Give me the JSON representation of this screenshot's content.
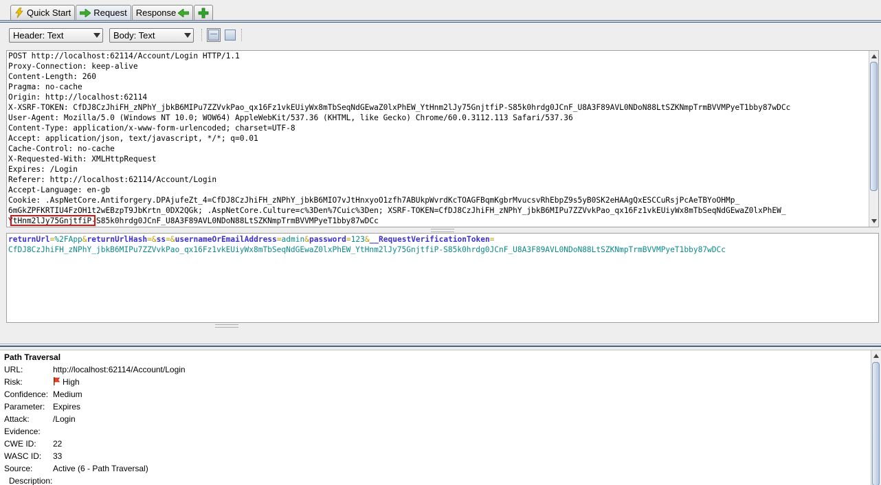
{
  "tabs": [
    {
      "label": "Quick Start",
      "icon": "lightning-icon",
      "active": false
    },
    {
      "label": "Request",
      "icon": "green-arrow-right-icon",
      "active": true
    },
    {
      "label": "Response",
      "icon": "green-arrow-left-icon",
      "active": false
    },
    {
      "label": "",
      "icon": "add-tab-icon",
      "active": false
    }
  ],
  "toolbar": {
    "header_view": "Header: Text",
    "body_view": "Body: Text"
  },
  "request_header": {
    "lines": [
      "POST http://localhost:62114/Account/Login HTTP/1.1",
      "Proxy-Connection: keep-alive",
      "Content-Length: 260",
      "Pragma: no-cache",
      "Origin: http://localhost:62114",
      "X-XSRF-TOKEN: CfDJ8CzJhiFH_zNPhY_jbkB6MIPu7ZZVvkPao_qx16Fz1vkEUiyWx8mTbSeqNdGEwaZ0lxPhEW_YtHnm2lJy75GnjtfiP-S85k0hrdg0JCnF_U8A3F89AVL0NDoN88LtSZKNmpTrmBVVMPyeT1bby87wDCc",
      "User-Agent: Mozilla/5.0 (Windows NT 10.0; WOW64) AppleWebKit/537.36 (KHTML, like Gecko) Chrome/60.0.3112.113 Safari/537.36",
      "Content-Type: application/x-www-form-urlencoded; charset=UTF-8",
      "Accept: application/json, text/javascript, */*; q=0.01",
      "Cache-Control: no-cache",
      "X-Requested-With: XMLHttpRequest",
      "Expires: /Login",
      "Referer: http://localhost:62114/Account/Login",
      "Accept-Language: en-gb",
      "Cookie: .AspNetCore.Antiforgery.DPAjufeZt_4=CfDJ8CzJhiFH_zNPhY_jbkB6MIO7vJtHnxyoO1zfh7ABUkpWvrdKcTOAGFBqmKgbrMvucsvRhEbpZ9s5yB0SK2eHAAgQxESCCuRsjPcAeTBYoOHMp_",
      "6mGkZPFKRTIU4FzOH1t2wEBzpT9JbKrtn_0DX2QGk; .AspNetCore.Culture=c%3Den%7Cuic%3Den; XSRF-TOKEN=CfDJ8CzJhiFH_zNPhY_jbkB6MIPu7ZZVvkPao_qx16Fz1vkEUiyWx8mTbSeqNdGEwaZ0lxPhEW_",
      "YtHnm2lJy75GnjtfiP-S85k0hrdg0JCnF_U8A3F89AVL0NDoN88LtSZKNmpTrmBVVMPyeT1bby87wDCc"
    ]
  },
  "request_body": {
    "segments": [
      {
        "t": "k",
        "s": "returnUrl"
      },
      {
        "t": "o",
        "s": "="
      },
      {
        "t": "v",
        "s": "%2FApp"
      },
      {
        "t": "o",
        "s": "&"
      },
      {
        "t": "k",
        "s": "returnUrlHash"
      },
      {
        "t": "o",
        "s": "="
      },
      {
        "t": "o",
        "s": "&"
      },
      {
        "t": "k",
        "s": "ss"
      },
      {
        "t": "o",
        "s": "="
      },
      {
        "t": "o",
        "s": "&"
      },
      {
        "t": "k",
        "s": "usernameOrEmailAddress"
      },
      {
        "t": "o",
        "s": "="
      },
      {
        "t": "v",
        "s": "admin"
      },
      {
        "t": "o",
        "s": "&"
      },
      {
        "t": "k",
        "s": "password"
      },
      {
        "t": "o",
        "s": "="
      },
      {
        "t": "v",
        "s": "123"
      },
      {
        "t": "o",
        "s": "&"
      },
      {
        "t": "k",
        "s": "__RequestVerificationToken"
      },
      {
        "t": "o",
        "s": "="
      },
      {
        "t": "br",
        "s": ""
      },
      {
        "t": "v",
        "s": "CfDJ8CzJhiFH_zNPhY_jbkB6MIPu7ZZVvkPao_qx16Fz1vkEUiyWx8mTbSeqNdGEwaZ0lxPhEW_YtHnm2lJy75GnjtfiP-S85k0hrdg0JCnF_U8A3F89AVL0NDoN88LtSZKNmpTrmBVVMPyeT1bby87wDCc"
      }
    ]
  },
  "alert": {
    "title": "Path Traversal",
    "fields": [
      {
        "label": "URL:",
        "value": "http://localhost:62114/Account/Login"
      },
      {
        "label": "Risk:",
        "value": "High",
        "icon": "red-flag-icon"
      },
      {
        "label": "Confidence:",
        "value": "Medium"
      },
      {
        "label": "Parameter:",
        "value": "Expires"
      },
      {
        "label": "Attack:",
        "value": "/Login"
      },
      {
        "label": "Evidence:",
        "value": ""
      },
      {
        "label": "CWE ID:",
        "value": "22"
      },
      {
        "label": "WASC ID:",
        "value": "33"
      },
      {
        "label": "Source:",
        "value": "Active (6 - Path Traversal)"
      },
      {
        "label": "Description:",
        "value": ""
      }
    ]
  },
  "colors": {
    "highlight_box": "#e01010",
    "body_key": "#3a2fd6",
    "body_operator": "#c29b00",
    "body_value": "#0a8a8a"
  }
}
